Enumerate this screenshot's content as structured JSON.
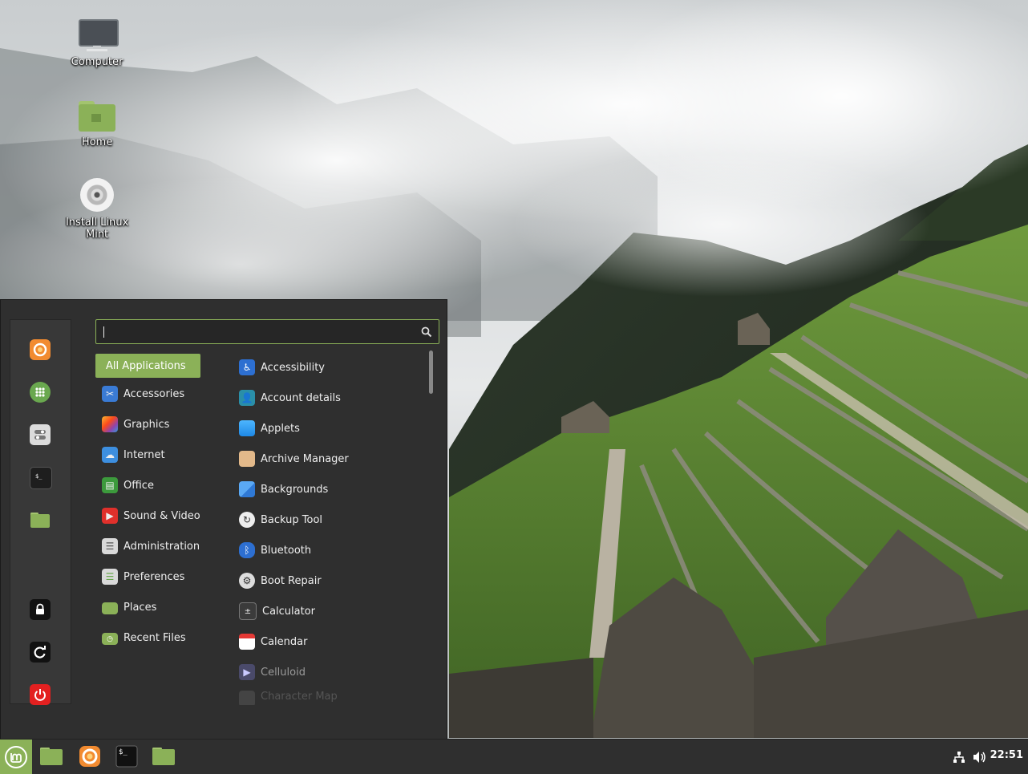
{
  "desktop": {
    "icons": [
      {
        "label": "Computer"
      },
      {
        "label": "Home"
      },
      {
        "label": "Install Linux Mint"
      }
    ]
  },
  "menu": {
    "search": {
      "value": ""
    },
    "favorites": [
      "firefox-icon",
      "software-manager-icon",
      "settings-icon",
      "terminal-icon",
      "files-icon"
    ],
    "session": [
      "lock-icon",
      "logout-icon",
      "power-icon"
    ],
    "categories": [
      {
        "label": "All Applications",
        "active": true
      },
      {
        "label": "Accessories"
      },
      {
        "label": "Graphics"
      },
      {
        "label": "Internet"
      },
      {
        "label": "Office"
      },
      {
        "label": "Sound & Video"
      },
      {
        "label": "Administration"
      },
      {
        "label": "Preferences"
      },
      {
        "label": "Places"
      },
      {
        "label": "Recent Files"
      }
    ],
    "apps": [
      {
        "label": "Accessibility"
      },
      {
        "label": "Account details"
      },
      {
        "label": "Applets"
      },
      {
        "label": "Archive Manager"
      },
      {
        "label": "Backgrounds"
      },
      {
        "label": "Backup Tool"
      },
      {
        "label": "Bluetooth"
      },
      {
        "label": "Boot Repair"
      },
      {
        "label": "Calculator"
      },
      {
        "label": "Calendar"
      },
      {
        "label": "Celluloid"
      },
      {
        "label": "Character Map"
      }
    ]
  },
  "panel": {
    "clock": "22:51",
    "tasks": [
      "files-icon",
      "firefox-icon",
      "terminal-icon",
      "files-icon"
    ]
  },
  "colors": {
    "accent": "#8bb158",
    "panel": "#2f2f2f",
    "menu": "#2f2f2f"
  }
}
